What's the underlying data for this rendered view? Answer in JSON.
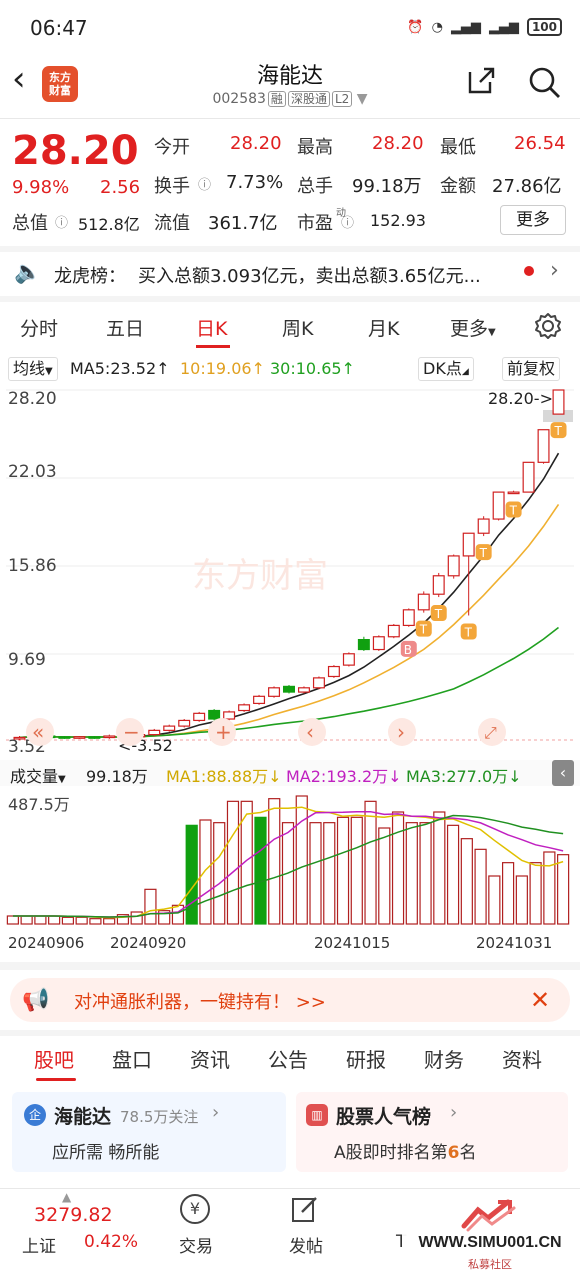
{
  "status": {
    "time": "06:47",
    "battery": "100",
    "signal": "4G"
  },
  "header": {
    "title": "海能达",
    "code": "002583",
    "tags": [
      "融",
      "深股通",
      "L2"
    ],
    "logo_line1": "东方",
    "logo_line2": "财富"
  },
  "quote": {
    "price": "28.20",
    "pct": "9.98%",
    "chg": "2.56",
    "open_label": "今开",
    "open": "28.20",
    "high_label": "最高",
    "high": "28.20",
    "low_label": "最低",
    "low": "26.54",
    "turnover_label": "换手",
    "turnover": "7.73%",
    "volume_label": "总手",
    "volume": "99.18万",
    "amount_label": "金额",
    "amount": "27.86亿",
    "mcap_label": "总值",
    "mcap": "512.8亿",
    "float_label": "流值",
    "float": "361.7亿",
    "pe_label": "市盈",
    "pe_sup": "动",
    "pe": "152.93",
    "more": "更多"
  },
  "dragon": {
    "label": "龙虎榜：",
    "text": "买入总额3.093亿元，卖出总额3.65亿元..."
  },
  "tabs": [
    "分时",
    "五日",
    "日K",
    "周K",
    "月K",
    "更多"
  ],
  "ma": {
    "btn": "均线",
    "ma5": "MA5:23.52↑",
    "ma10": "10:19.06↑",
    "ma30": "30:10.65↑",
    "dk": "DK点",
    "fq": "前复权",
    "c_ma5": "#222222",
    "c_ma10": "#f0b030",
    "c_ma30": "#20a020"
  },
  "kline": {
    "y_labels": [
      "28.20",
      "22.03",
      "15.86",
      "9.69",
      "3.52"
    ],
    "max_marker": "28.20->",
    "min_marker": "<-3.52",
    "watermark": "东方财富",
    "buy_mark": "B",
    "hold_mark": "T"
  },
  "volume": {
    "btn": "成交量",
    "total": "99.18万",
    "ma1": "MA1:88.88万↓",
    "ma2": "MA2:193.2万↓",
    "ma3": "MA3:277.0万↓",
    "ymax": "487.5万",
    "c_ma1": "#e0c000",
    "c_ma2": "#c020c0",
    "c_ma3": "#209020"
  },
  "dates": [
    "20240906",
    "20240920",
    "20241015",
    "20241031"
  ],
  "promo": {
    "text": "对冲通胀利器，一键持有！ >>"
  },
  "btabs": [
    "股吧",
    "盘口",
    "资讯",
    "公告",
    "研报",
    "财务",
    "资料"
  ],
  "card1": {
    "title": "海能达",
    "follow": "78.5万关注",
    "sub": "应所需 畅所能",
    "badge": "企"
  },
  "card2": {
    "title": "股票人气榜",
    "sub_pre": "A股即时排名第",
    "rank": "6",
    "sub_post": "名"
  },
  "bottom": {
    "index_value": "3279.82",
    "index_name": "上证",
    "index_pct": "0.42%",
    "trade": "交易",
    "post": "发帖",
    "partial": "T"
  },
  "site_watermark": {
    "url": "WWW.SIMU001.CN",
    "name": "私募社区"
  },
  "chart_data": {
    "type": "candlestick",
    "y_range": [
      3.52,
      28.2
    ],
    "candles_ohlc": [
      [
        3.6,
        3.8,
        3.5,
        3.7
      ],
      [
        3.7,
        3.9,
        3.6,
        3.8
      ],
      [
        3.8,
        3.9,
        3.7,
        3.75
      ],
      [
        3.75,
        3.8,
        3.6,
        3.65
      ],
      [
        3.65,
        3.8,
        3.6,
        3.75
      ],
      [
        3.75,
        3.8,
        3.6,
        3.7
      ],
      [
        3.7,
        3.9,
        3.6,
        3.8
      ],
      [
        3.8,
        3.9,
        3.7,
        3.75
      ],
      [
        3.75,
        4.0,
        3.7,
        3.9
      ],
      [
        3.9,
        4.3,
        3.8,
        4.2
      ],
      [
        4.2,
        4.6,
        4.1,
        4.5
      ],
      [
        4.5,
        5.0,
        4.4,
        4.9
      ],
      [
        4.9,
        5.5,
        4.8,
        5.4
      ],
      [
        5.6,
        5.7,
        4.9,
        5.0
      ],
      [
        5.0,
        5.6,
        4.9,
        5.5
      ],
      [
        5.6,
        6.1,
        5.5,
        6.0
      ],
      [
        6.1,
        6.7,
        6.0,
        6.6
      ],
      [
        6.6,
        7.3,
        6.5,
        7.2
      ],
      [
        7.3,
        7.4,
        6.8,
        6.9
      ],
      [
        6.9,
        7.3,
        6.8,
        7.2
      ],
      [
        7.2,
        8.0,
        7.1,
        7.9
      ],
      [
        8.0,
        8.8,
        7.9,
        8.7
      ],
      [
        8.8,
        9.7,
        8.7,
        9.6
      ],
      [
        10.6,
        10.8,
        9.8,
        9.9
      ],
      [
        9.9,
        10.9,
        9.8,
        10.8
      ],
      [
        10.8,
        11.7,
        10.7,
        11.6
      ],
      [
        11.6,
        12.8,
        11.5,
        12.7
      ],
      [
        12.7,
        14.0,
        12.5,
        13.8
      ],
      [
        13.8,
        15.3,
        13.6,
        15.1
      ],
      [
        15.1,
        16.6,
        14.9,
        16.5
      ],
      [
        16.5,
        18.1,
        12.3,
        18.1
      ],
      [
        18.1,
        19.3,
        17.9,
        19.1
      ],
      [
        19.1,
        21.0,
        19.0,
        21.0
      ],
      [
        21.0,
        21.1,
        20.9,
        21.0
      ],
      [
        21.0,
        23.1,
        21.0,
        23.1
      ],
      [
        23.1,
        25.4,
        23.0,
        25.4
      ],
      [
        26.5,
        28.2,
        26.5,
        28.2
      ]
    ],
    "volume_wan": [
      30,
      30,
      30,
      30,
      25,
      25,
      20,
      20,
      35,
      45,
      130,
      50,
      70,
      370,
      390,
      380,
      460,
      460,
      400,
      470,
      380,
      480,
      380,
      380,
      400,
      400,
      460,
      360,
      420,
      380,
      380,
      420,
      370,
      320,
      280,
      180,
      230,
      180,
      230,
      270,
      260
    ]
  }
}
